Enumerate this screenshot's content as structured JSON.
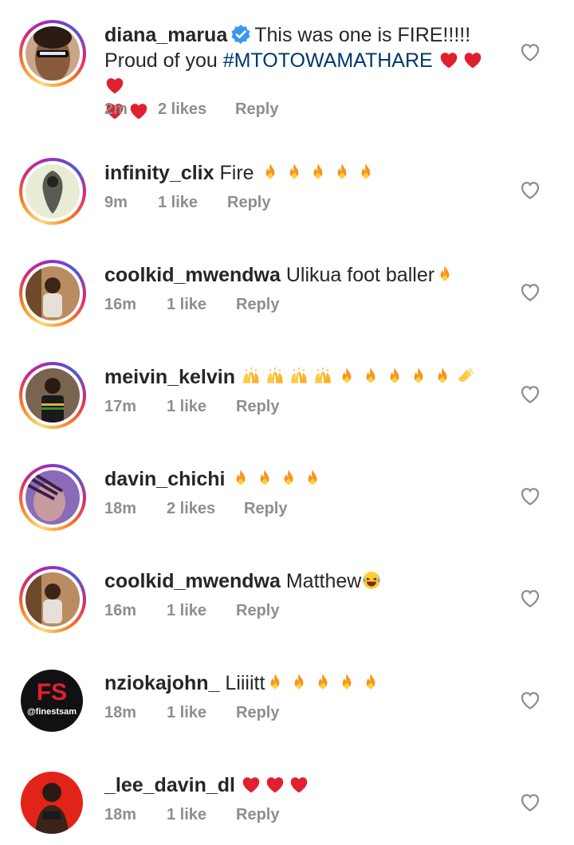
{
  "comments": [
    {
      "username": "diana_marua",
      "verified": true,
      "text_line1": "This was one is FIRE!!!!!",
      "text_line2_prefix": "Proud of you",
      "hashtag": "#MTOTOWAMATHARE",
      "emojis": [
        "heart",
        "heart",
        "heart",
        "heart",
        "heart"
      ],
      "time": "2m",
      "likes": "2 likes",
      "reply": "Reply",
      "avatar_icon": "avatar-sunglasses-woman"
    },
    {
      "username": "infinity_clix",
      "text": "Fire",
      "emojis": [
        "fire",
        "fire",
        "fire",
        "fire",
        "fire"
      ],
      "time": "9m",
      "likes": "1 like",
      "reply": "Reply",
      "avatar_icon": "avatar-abstract-figure"
    },
    {
      "username": "coolkid_mwendwa",
      "text": "Ulikua foot baller",
      "emojis": [
        "fire"
      ],
      "time": "16m",
      "likes": "1 like",
      "reply": "Reply",
      "avatar_icon": "avatar-boy-smiling"
    },
    {
      "username": "meivin_kelvin",
      "text": "",
      "emojis": [
        "raised-hands",
        "raised-hands",
        "raised-hands",
        "raised-hands",
        "fire",
        "fire",
        "fire",
        "fire",
        "fire",
        "clap"
      ],
      "time": "17m",
      "likes": "1 like",
      "reply": "Reply",
      "avatar_icon": "avatar-boy-striped-shirt"
    },
    {
      "username": "davin_chichi",
      "text": "",
      "emojis": [
        "fire",
        "fire",
        "fire",
        "fire"
      ],
      "time": "18m",
      "likes": "2 likes",
      "reply": "Reply",
      "avatar_icon": "avatar-woman-braids"
    },
    {
      "username": "coolkid_mwendwa",
      "text": "Matthew",
      "emojis": [
        "laughing"
      ],
      "time": "16m",
      "likes": "1 like",
      "reply": "Reply",
      "avatar_icon": "avatar-boy-smiling"
    },
    {
      "username": "nziokajohn_",
      "text": "Liiiitt",
      "emojis": [
        "fire",
        "fire",
        "fire",
        "fire",
        "fire"
      ],
      "time": "18m",
      "likes": "1 like",
      "reply": "Reply",
      "avatar_icon": "avatar-fs-logo",
      "avatar_logo_big": "FS",
      "avatar_logo_small": "@finestsam"
    },
    {
      "username": "_lee_davin_dl",
      "text": "",
      "emojis": [
        "heart",
        "heart",
        "heart"
      ],
      "time": "18m",
      "likes": "1 like",
      "reply": "Reply",
      "avatar_icon": "avatar-person-red"
    }
  ],
  "colors": {
    "hashtag": "#00376b",
    "meta": "#8e8e8e",
    "heart": "#e0202f",
    "fire": "#f7941d",
    "verified": "#3897f0"
  }
}
